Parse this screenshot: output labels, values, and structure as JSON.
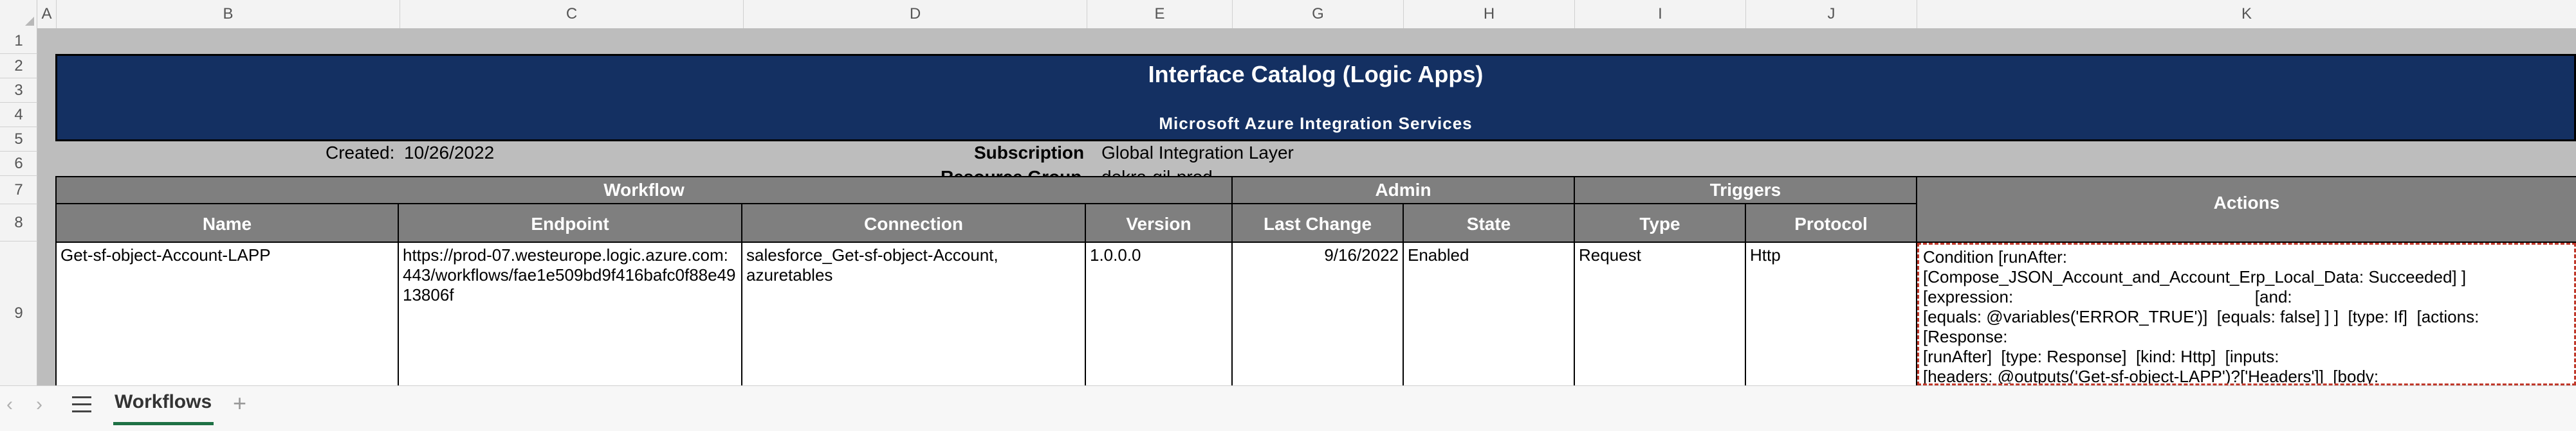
{
  "columns": [
    "A",
    "B",
    "C",
    "D",
    "E",
    "G",
    "H",
    "I",
    "J",
    "K"
  ],
  "rows": [
    "1",
    "2",
    "3",
    "4",
    "5",
    "6",
    "7",
    "8",
    "9"
  ],
  "title": "Interface Catalog (Logic Apps)",
  "subtitle": "Microsoft Azure Integration Services",
  "meta": {
    "created_label": "Created:",
    "created_value": "10/26/2022",
    "subscription_label": "Subscription",
    "subscription_value": "Global Integration Layer",
    "resource_group_label": "Resource Group",
    "resource_group_value": "dekra-gil-prod"
  },
  "groups": {
    "workflow": "Workflow",
    "admin": "Admin",
    "triggers": "Triggers",
    "actions": "Actions"
  },
  "headers": {
    "name": "Name",
    "endpoint": "Endpoint",
    "connection": "Connection",
    "version": "Version",
    "last_change": "Last Change",
    "state": "State",
    "type": "Type",
    "protocol": "Protocol"
  },
  "row9": {
    "name": "Get-sf-object-Account-LAPP",
    "endpoint": "https://prod-07.westeurope.logic.azure.com:443/workflows/fae1e509bd9f416bafc0f88e4913806f",
    "connection": "salesforce_Get-sf-object-Account, azuretables",
    "version": "1.0.0.0",
    "last_change": "9/16/2022",
    "state": "Enabled",
    "type": "Request",
    "protocol": "Http",
    "actions": [
      "Condition [runAfter:",
      "[Compose_JSON_Account_and_Account_Erp_Local_Data: Succeeded] ]",
      "[expression:                                                    [and:",
      "[equals: @variables('ERROR_TRUE')]  [equals: false] ] ]  [type: If]  [actions:",
      "[Response:",
      "[runAfter]  [type: Response]  [kind: Http]  [inputs:",
      "[headers: @outputs('Get-sf-object-LAPP')?['Headers']]  [body:"
    ]
  },
  "sheet_tab": "Workflows"
}
